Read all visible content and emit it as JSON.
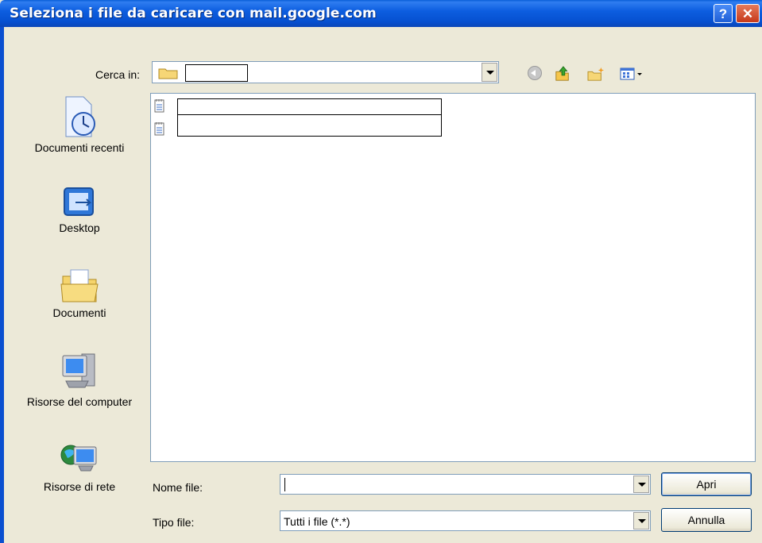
{
  "window": {
    "title": "Seleziona i file da caricare con mail.google.com",
    "help_glyph": "?",
    "close_glyph": "✕"
  },
  "lookin": {
    "label": "Cerca in:",
    "current_value": ""
  },
  "toolbar": {
    "icons": [
      "back-icon",
      "up-folder-icon",
      "new-folder-icon",
      "views-menu-icon"
    ]
  },
  "places": [
    {
      "label": "Documenti recenti",
      "icon": "recent-documents-icon"
    },
    {
      "label": "Desktop",
      "icon": "desktop-icon"
    },
    {
      "label": "Documenti",
      "icon": "documents-folder-icon"
    },
    {
      "label": "Risorse del computer",
      "icon": "my-computer-icon"
    },
    {
      "label": "Risorse di rete",
      "icon": "network-icon"
    }
  ],
  "files": [
    {
      "name": "",
      "icon": "text-file-icon"
    },
    {
      "name": "",
      "icon": "text-file-icon"
    }
  ],
  "filename": {
    "label": "Nome file:",
    "value": ""
  },
  "filetype": {
    "label": "Tipo file:",
    "value": "Tutti i file (*.*)"
  },
  "buttons": {
    "open": "Apri",
    "cancel": "Annulla"
  },
  "colors": {
    "titlebar": "#0650d0",
    "dialog_bg": "#ece9d8",
    "field_border": "#7f9db9"
  }
}
